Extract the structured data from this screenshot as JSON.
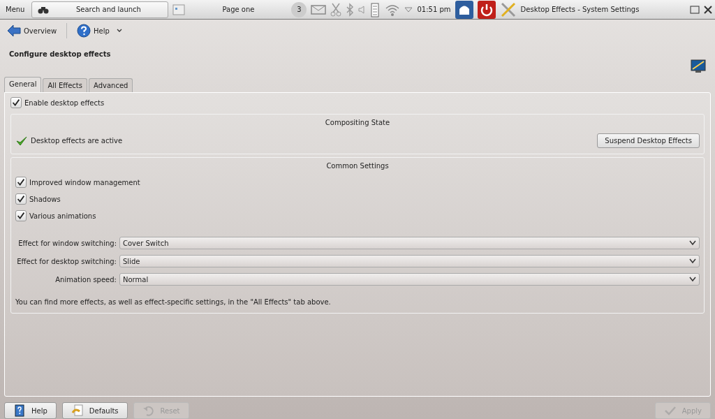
{
  "panel": {
    "menu": "Menu",
    "search": "Search and launch",
    "pager": "Page one",
    "notifications": "3",
    "clock": "01:51 pm",
    "window_title": "Desktop Effects - System Settings"
  },
  "toolbar": [
    {
      "kind": "back",
      "label": "Overview"
    },
    {
      "kind": "help",
      "label": "Help"
    }
  ],
  "heading": "Configure desktop effects",
  "tabs": [
    {
      "label": "General",
      "selected": true
    },
    {
      "label": "All Effects",
      "selected": false
    },
    {
      "label": "Advanced",
      "selected": false
    }
  ],
  "enable": {
    "label": "Enable desktop effects",
    "checked": true
  },
  "compositing": {
    "title": "Compositing State",
    "status": "Desktop effects are active",
    "button": "Suspend Desktop Effects"
  },
  "common": {
    "title": "Common Settings",
    "options": [
      {
        "label": "Improved window management",
        "checked": true
      },
      {
        "label": "Shadows",
        "checked": true
      },
      {
        "label": "Various animations",
        "checked": true
      }
    ],
    "selects": [
      {
        "label": "Effect for window switching:",
        "value": "Cover Switch"
      },
      {
        "label": "Effect for desktop switching:",
        "value": "Slide"
      },
      {
        "label": "Animation speed:",
        "value": "Normal"
      }
    ],
    "note": "You can find more effects, as well as effect-specific settings, in the \"All Effects\" tab above."
  },
  "buttons": [
    {
      "kind": "help",
      "label": "Help",
      "disabled": false
    },
    {
      "kind": "defaults",
      "label": "Defaults",
      "disabled": false
    },
    {
      "kind": "reset",
      "label": "Reset",
      "disabled": true
    },
    {
      "kind": "apply",
      "label": "Apply",
      "disabled": true
    }
  ]
}
